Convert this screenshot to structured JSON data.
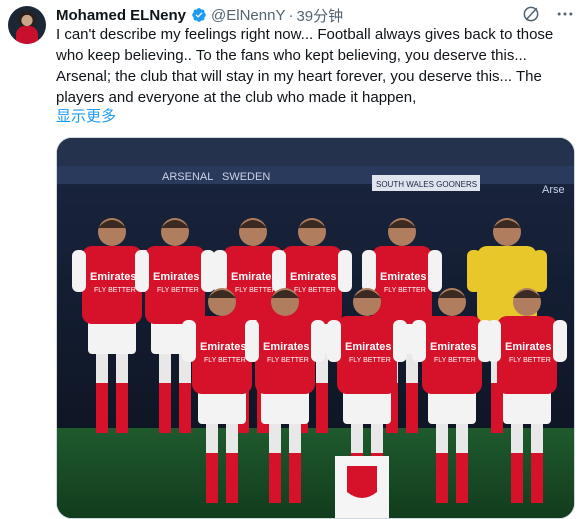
{
  "author": {
    "name": "Mohamed ELNeny",
    "handle": "@ElNennY",
    "time": "39分钟",
    "separator": "·"
  },
  "tweet": {
    "text": "I can't describe my feelings right now... Football always gives back to those who keep believing.. To the fans who kept believing, you deserve this... Arsenal; the club that will stay in my heart forever, you deserve this... The players and everyone at the club who made it happen,",
    "show_more": "显示更多"
  },
  "media": {
    "stadium_boards": [
      "ARSENAL",
      "SWEDEN",
      "SOUTH WALES GOONERS",
      "Arse"
    ],
    "sponsor": "Emirates",
    "sponsor_sub": "FLY BETTER"
  },
  "colors": {
    "accent": "#1d9bf0",
    "verified": "#1d9bf0",
    "arsenal_red": "#d5122a",
    "muted": "#536471"
  },
  "icons": {
    "verified": "verified-badge-icon",
    "grok": "grok-icon",
    "more": "more-icon"
  }
}
